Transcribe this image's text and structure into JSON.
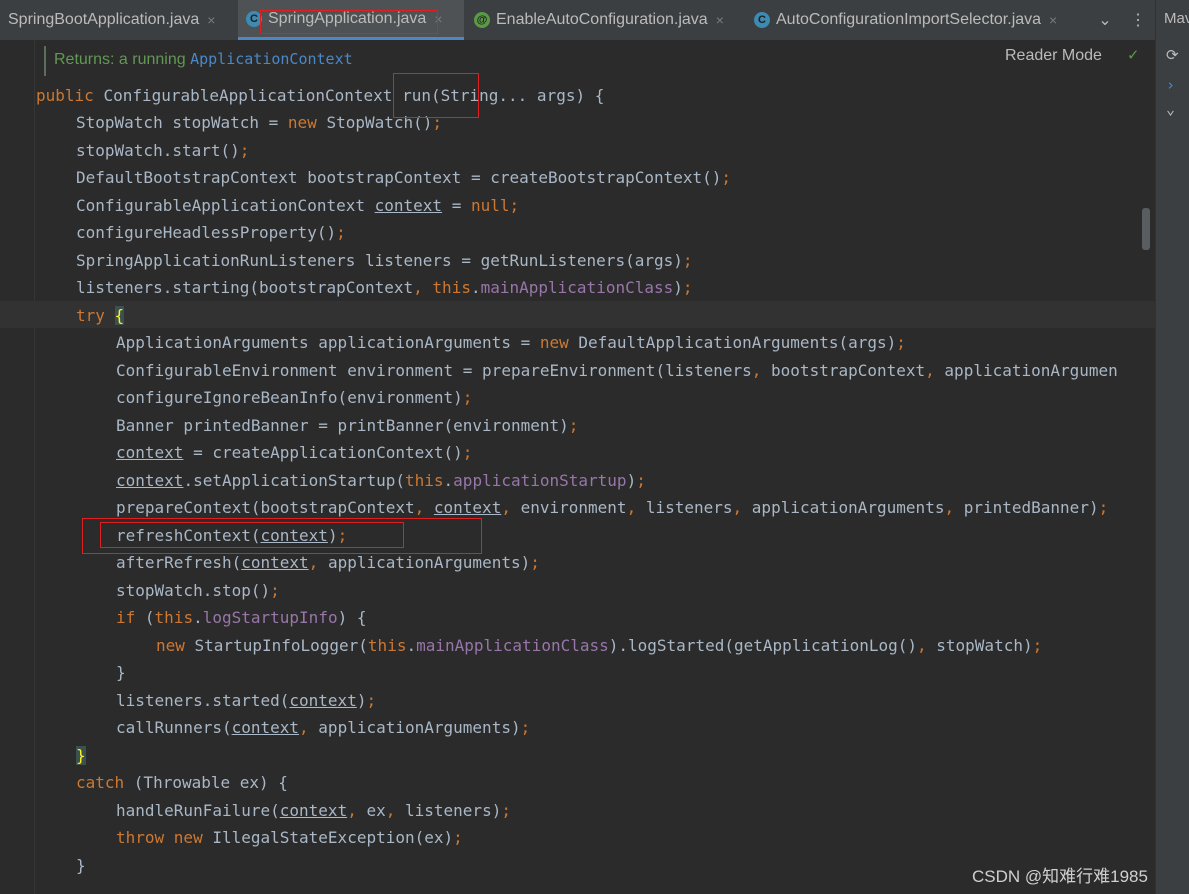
{
  "tabs": [
    {
      "label": "SpringBootApplication.java",
      "icon": "java-class-icon",
      "active": false
    },
    {
      "label": "SpringApplication.java",
      "icon": "java-class-icon",
      "active": true
    },
    {
      "label": "EnableAutoConfiguration.java",
      "icon": "annotation-icon",
      "active": false
    },
    {
      "label": "AutoConfigurationImportSelector.java",
      "icon": "java-class-icon",
      "active": false
    }
  ],
  "tab_icons": {
    "class_glyph": "C",
    "annotation_glyph": "@",
    "close_glyph": "×",
    "more_glyph": "⌄",
    "menu_glyph": "⋮"
  },
  "right_panel": {
    "label": "Mav"
  },
  "doc": {
    "returns_label": "Returns: a running",
    "returns_type": "ApplicationContext"
  },
  "reader_mode": "Reader Mode",
  "code": {
    "l1": {
      "a": "public ",
      "b": "ConfigurableApplicationContext ",
      "c": "run",
      "d": "(String... args) {"
    },
    "l2": {
      "a": "StopWatch stopWatch = ",
      "b": "new ",
      "c": "StopWatch()",
      "d": ";"
    },
    "l3": {
      "a": "stopWatch.start()",
      "b": ";"
    },
    "l4": {
      "a": "DefaultBootstrapContext bootstrapContext = createBootstrapContext()",
      "b": ";"
    },
    "l5": {
      "a": "ConfigurableApplicationContext ",
      "b": "context",
      "c": " = ",
      "d": "null",
      "e": ";"
    },
    "l6": {
      "a": "configureHeadlessProperty()",
      "b": ";"
    },
    "l7": {
      "a": "SpringApplicationRunListeners listeners = getRunListeners(args)",
      "b": ";"
    },
    "l8": {
      "a": "listeners.starting(bootstrapContext",
      "b": ", ",
      "c": "this",
      "d": ".",
      "e": "mainApplicationClass",
      "f": ")",
      "g": ";"
    },
    "l9": {
      "a": "try ",
      "b": "{"
    },
    "l10": {
      "a": "ApplicationArguments applicationArguments = ",
      "b": "new ",
      "c": "DefaultApplicationArguments(args)",
      "d": ";"
    },
    "l11": {
      "a": "ConfigurableEnvironment environment = prepareEnvironment(listeners",
      "b": ", ",
      "c": "bootstrapContext",
      "d": ", ",
      "e": "applicationArgumen"
    },
    "l12": {
      "a": "configureIgnoreBeanInfo(environment)",
      "b": ";"
    },
    "l13": {
      "a": "Banner printedBanner = printBanner(environment)",
      "b": ";"
    },
    "l14": {
      "a": "context",
      "b": " = createApplicationContext()",
      "c": ";"
    },
    "l15": {
      "a": "context",
      "b": ".setApplicationStartup(",
      "c": "this",
      "d": ".",
      "e": "applicationStartup",
      "f": ")",
      "g": ";"
    },
    "l16": {
      "a": "prepareContext(bootstrapContext",
      "b": ", ",
      "c": "context",
      "d": ", ",
      "e": "environment",
      "f": ", ",
      "g": "listeners",
      "h": ", ",
      "i": "applicationArguments",
      "j": ", ",
      "k": "printedBanner)",
      "l": ";"
    },
    "l17": {
      "a": "refreshContext(",
      "b": "context",
      "c": ")",
      "d": ";"
    },
    "l18": {
      "a": "afterRefresh(",
      "b": "context",
      "c": ", ",
      "d": "applicationArguments)",
      "e": ";"
    },
    "l19": {
      "a": "stopWatch.stop()",
      "b": ";"
    },
    "l20": {
      "a": "if ",
      "b": "(",
      "c": "this",
      "d": ".",
      "e": "logStartupInfo",
      "f": ") {"
    },
    "l21": {
      "a": "new ",
      "b": "StartupInfoLogger(",
      "c": "this",
      "d": ".",
      "e": "mainApplicationClass",
      "f": ").logStarted(getApplicationLog()",
      "g": ", ",
      "h": "stopWatch)",
      "i": ";"
    },
    "l22": {
      "a": "}"
    },
    "l23": {
      "a": "listeners.started(",
      "b": "context",
      "c": ")",
      "d": ";"
    },
    "l24": {
      "a": "callRunners(",
      "b": "context",
      "c": ", ",
      "d": "applicationArguments)",
      "e": ";"
    },
    "l25": {
      "a": "}"
    },
    "l26": {
      "a": "catch ",
      "b": "(Throwable ex) {"
    },
    "l27": {
      "a": "handleRunFailure(",
      "b": "context",
      "c": ", ",
      "d": "ex",
      "e": ", ",
      "f": "listeners)",
      "g": ";"
    },
    "l28": {
      "a": "throw ",
      "b": "new ",
      "c": "IllegalStateException(ex)",
      "d": ";"
    },
    "l29": {
      "a": "}"
    }
  },
  "watermark": "CSDN @知难行难1985",
  "colors": {
    "background": "#2b2b2b",
    "keyword": "#cc7832",
    "field": "#9876aa",
    "text": "#a9b7c6",
    "highlight_box": "#e02020"
  }
}
